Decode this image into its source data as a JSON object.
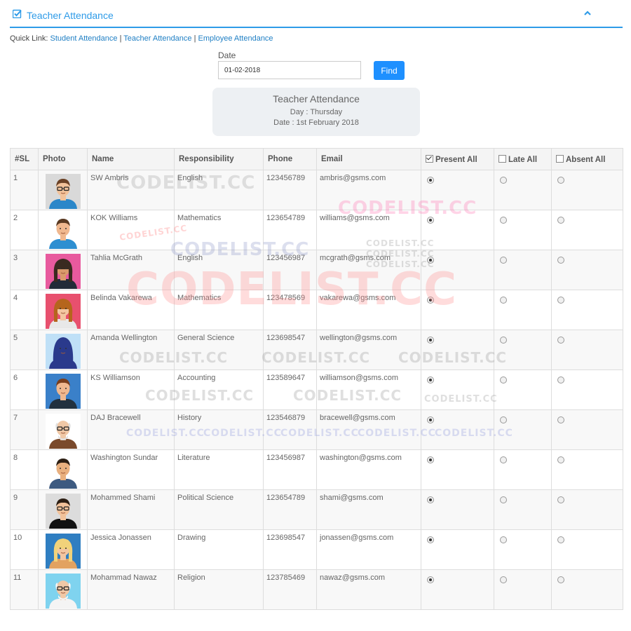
{
  "header": {
    "title": "Teacher Attendance"
  },
  "quick_links": {
    "prefix": "Quick Link:",
    "student": "Student Attendance",
    "teacher": "Teacher Attendance",
    "employee": "Employee Attendance",
    "separator": "|"
  },
  "date_form": {
    "label": "Date",
    "value": "01-02-2018",
    "find_label": "Find"
  },
  "info": {
    "title": "Teacher Attendance",
    "day": "Day : Thursday",
    "date": "Date : 1st February 2018"
  },
  "table": {
    "headers": [
      "#SL",
      "Photo",
      "Name",
      "Responsibility",
      "Phone",
      "Email",
      "Present All",
      "Late All",
      "Absent All"
    ],
    "rows": [
      {
        "sl": "1",
        "name": "SW Ambris",
        "responsibility": "English",
        "phone": "123456789",
        "email": "ambris@gsms.com",
        "status": "present"
      },
      {
        "sl": "2",
        "name": "KOK Williams",
        "responsibility": "Mathematics",
        "phone": "123654789",
        "email": "williams@gsms.com",
        "status": "present"
      },
      {
        "sl": "3",
        "name": "Tahlia McGrath",
        "responsibility": "English",
        "phone": "123456987",
        "email": "mcgrath@gsms.com",
        "status": "present"
      },
      {
        "sl": "4",
        "name": "Belinda Vakarewa",
        "responsibility": "Mathematics",
        "phone": "123478569",
        "email": "vakarewa@gsms.com",
        "status": "present"
      },
      {
        "sl": "5",
        "name": "Amanda Wellington",
        "responsibility": "General Science",
        "phone": "123698547",
        "email": "wellington@gsms.com",
        "status": "present"
      },
      {
        "sl": "6",
        "name": "KS Williamson",
        "responsibility": "Accounting",
        "phone": "123589647",
        "email": "williamson@gsms.com",
        "status": "present"
      },
      {
        "sl": "7",
        "name": "DAJ Bracewell",
        "responsibility": "History",
        "phone": "123546879",
        "email": "bracewell@gsms.com",
        "status": "present"
      },
      {
        "sl": "8",
        "name": "Washington Sundar",
        "responsibility": "Literature",
        "phone": "123456987",
        "email": "washington@gsms.com",
        "status": "present"
      },
      {
        "sl": "9",
        "name": "Mohammed Shami",
        "responsibility": "Political Science",
        "phone": "123654789",
        "email": "shami@gsms.com",
        "status": "present"
      },
      {
        "sl": "10",
        "name": "Jessica Jonassen",
        "responsibility": "Drawing",
        "phone": "123698547",
        "email": "jonassen@gsms.com",
        "status": "present"
      },
      {
        "sl": "11",
        "name": "Mohammad Nawaz",
        "responsibility": "Religion",
        "phone": "123785469",
        "email": "nawaz@gsms.com",
        "status": "present"
      }
    ]
  },
  "avatars": [
    {
      "bg": "#d9d9d9",
      "skin": "#f2c29a",
      "hair": "#6b4226",
      "shirt": "#2b87c9",
      "gender": "m",
      "glasses": true
    },
    {
      "bg": "#ffffff",
      "skin": "#f0b88f",
      "hair": "#5a3a22",
      "shirt": "#2e8fd1",
      "gender": "m",
      "glasses": false
    },
    {
      "bg": "#e85a9e",
      "skin": "#d99a6c",
      "hair": "#3a2a20",
      "shirt": "#222b38",
      "gender": "f",
      "glasses": false
    },
    {
      "bg": "#e8506e",
      "skin": "#f3c6a1",
      "hair": "#b5651d",
      "shirt": "#e8e8e8",
      "gender": "f",
      "glasses": false
    },
    {
      "bg": "#bfe0f7",
      "skin": "#f3c6a1",
      "hair": "#2a3a8c",
      "shirt": "#2a3a8c",
      "gender": "hijab",
      "glasses": false
    },
    {
      "bg": "#3a80c9",
      "skin": "#f0b88f",
      "hair": "#7a3e1c",
      "shirt": "#22313f",
      "gender": "m",
      "glasses": false
    },
    {
      "bg": "#ffffff",
      "skin": "#f0c8a6",
      "hair": "#e0e0e0",
      "shirt": "#7a4a2c",
      "gender": "old",
      "glasses": true
    },
    {
      "bg": "#ffffff",
      "skin": "#e9b07f",
      "hair": "#2d1f14",
      "shirt": "#3d5a80",
      "gender": "m",
      "glasses": false
    },
    {
      "bg": "#dcdcdc",
      "skin": "#f2c29a",
      "hair": "#2d1f14",
      "shirt": "#111111",
      "gender": "m",
      "glasses": true
    },
    {
      "bg": "#2f7ec1",
      "skin": "#f3c6a1",
      "hair": "#f1d27a",
      "shirt": "#e2a261",
      "gender": "f",
      "glasses": false
    },
    {
      "bg": "#7fd3ef",
      "skin": "#f0c8a6",
      "hair": "#f4f4f4",
      "shirt": "#f4f4f4",
      "gender": "old",
      "glasses": true
    }
  ],
  "watermark": "CODELIST.CC",
  "colors": {
    "accent": "#2e9be8",
    "find_button": "#1e90ff",
    "info_box": "#edf0f3"
  }
}
